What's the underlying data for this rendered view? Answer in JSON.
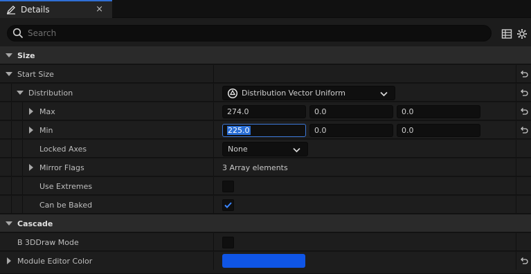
{
  "tab": {
    "title": "Details",
    "close": "×",
    "icon": "pencil-icon"
  },
  "search": {
    "placeholder": "Search",
    "value": ""
  },
  "toolbar_icons": [
    "table-icon",
    "gear-icon"
  ],
  "accent": "#2f6fd6",
  "categories": {
    "size": "Size",
    "cascade": "Cascade"
  },
  "props": {
    "start_size": "Start Size",
    "distribution": "Distribution",
    "distribution_value": "Distribution Vector Uniform",
    "max": "Max",
    "max_values": [
      "274.0",
      "0.0",
      "0.0"
    ],
    "min": "Min",
    "min_values": [
      "225.0",
      "0.0",
      "0.0"
    ],
    "locked_axes": "Locked Axes",
    "locked_axes_value": "None",
    "mirror_flags": "Mirror Flags",
    "mirror_flags_value": "3 Array elements",
    "use_extremes": "Use Extremes",
    "use_extremes_checked": false,
    "can_be_baked": "Can be Baked",
    "can_be_baked_checked": true,
    "b3d_draw_mode": "B 3DDraw Mode",
    "b3d_draw_mode_checked": false,
    "module_editor_color": "Module Editor Color",
    "module_editor_color_value": "#0f55e6"
  }
}
